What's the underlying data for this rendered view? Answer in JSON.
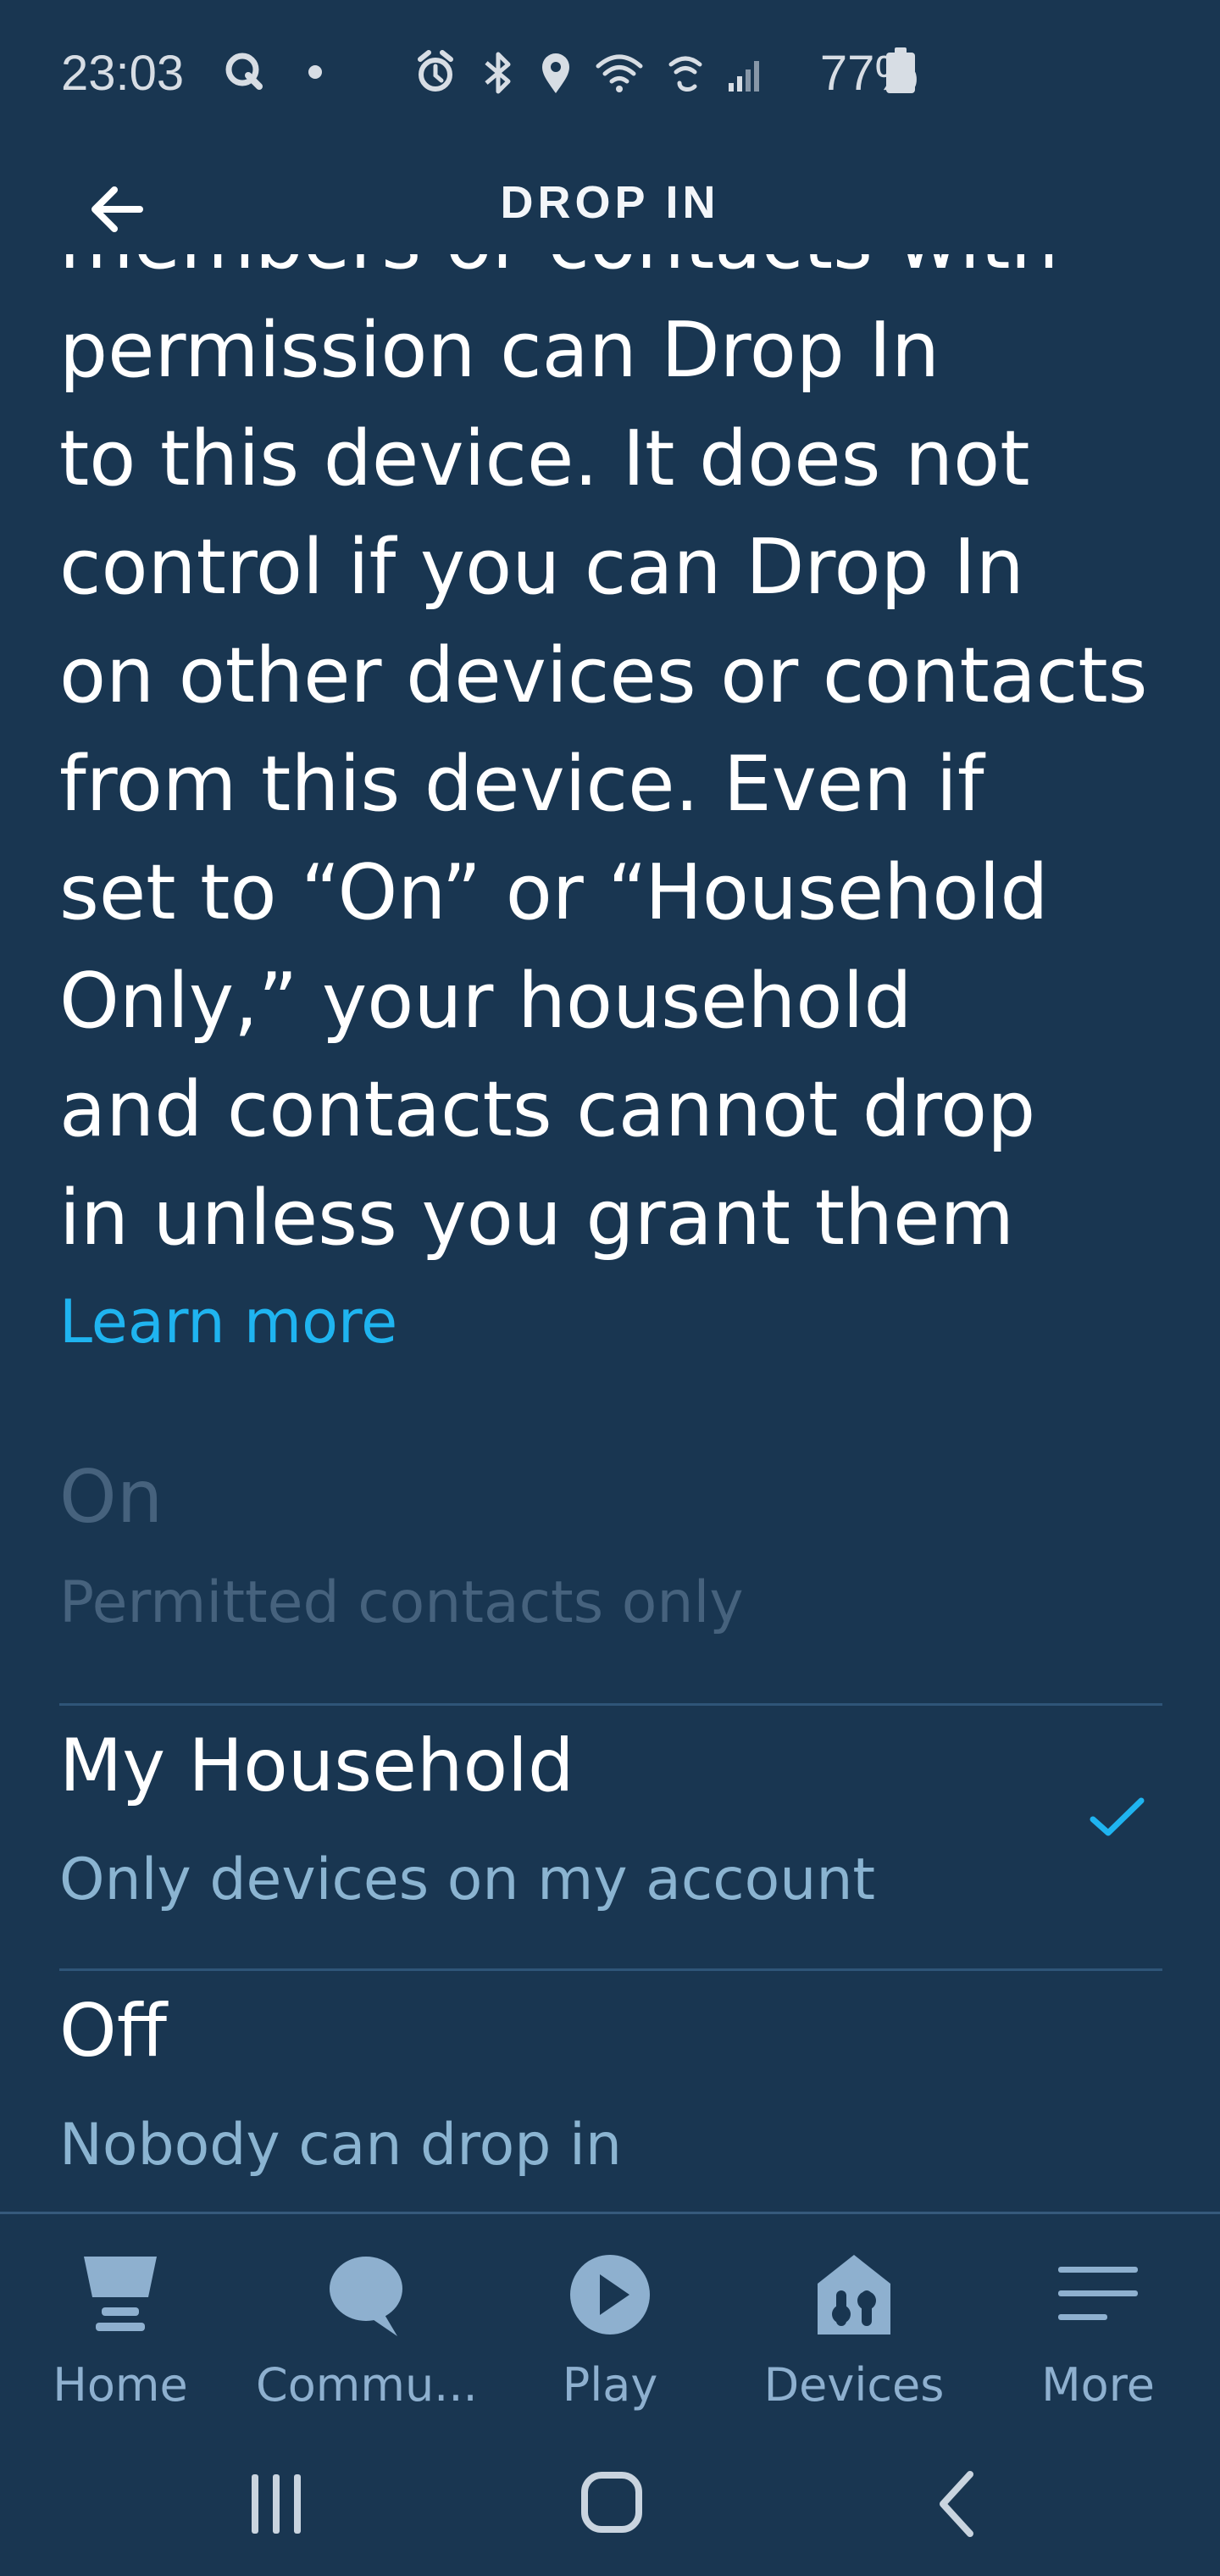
{
  "status_bar": {
    "time": "23:03",
    "battery": "77%"
  },
  "app_bar": {
    "title": "DROP IN"
  },
  "description": {
    "lines": [
      "members or contacts with",
      "permission can Drop In",
      "to this device. It does not",
      "control if you can Drop In",
      "on other devices or contacts",
      "from this device. Even if",
      "set to “On” or “Household",
      "Only,” your household",
      "and contacts cannot drop",
      "in unless you grant them"
    ],
    "learn_more": "Learn more"
  },
  "options": [
    {
      "title": "On",
      "subtitle": "Permitted contacts only",
      "selected": false,
      "disabled": true
    },
    {
      "title": "My Household",
      "subtitle": "Only devices on my account",
      "selected": true,
      "disabled": false
    },
    {
      "title": "Off",
      "subtitle": "Nobody can drop in",
      "selected": false,
      "disabled": false
    }
  ],
  "bottom_nav": [
    {
      "label": "Home",
      "icon": "home-icon"
    },
    {
      "label": "Commu...",
      "icon": "chat-icon"
    },
    {
      "label": "Play",
      "icon": "play-icon"
    },
    {
      "label": "Devices",
      "icon": "devices-icon"
    },
    {
      "label": "More",
      "icon": "menu-icon"
    }
  ],
  "colors": {
    "background": "#193651",
    "link": "#1fb4f0",
    "muted_text": "#8bb4d1",
    "disabled_text": "#46627d"
  }
}
